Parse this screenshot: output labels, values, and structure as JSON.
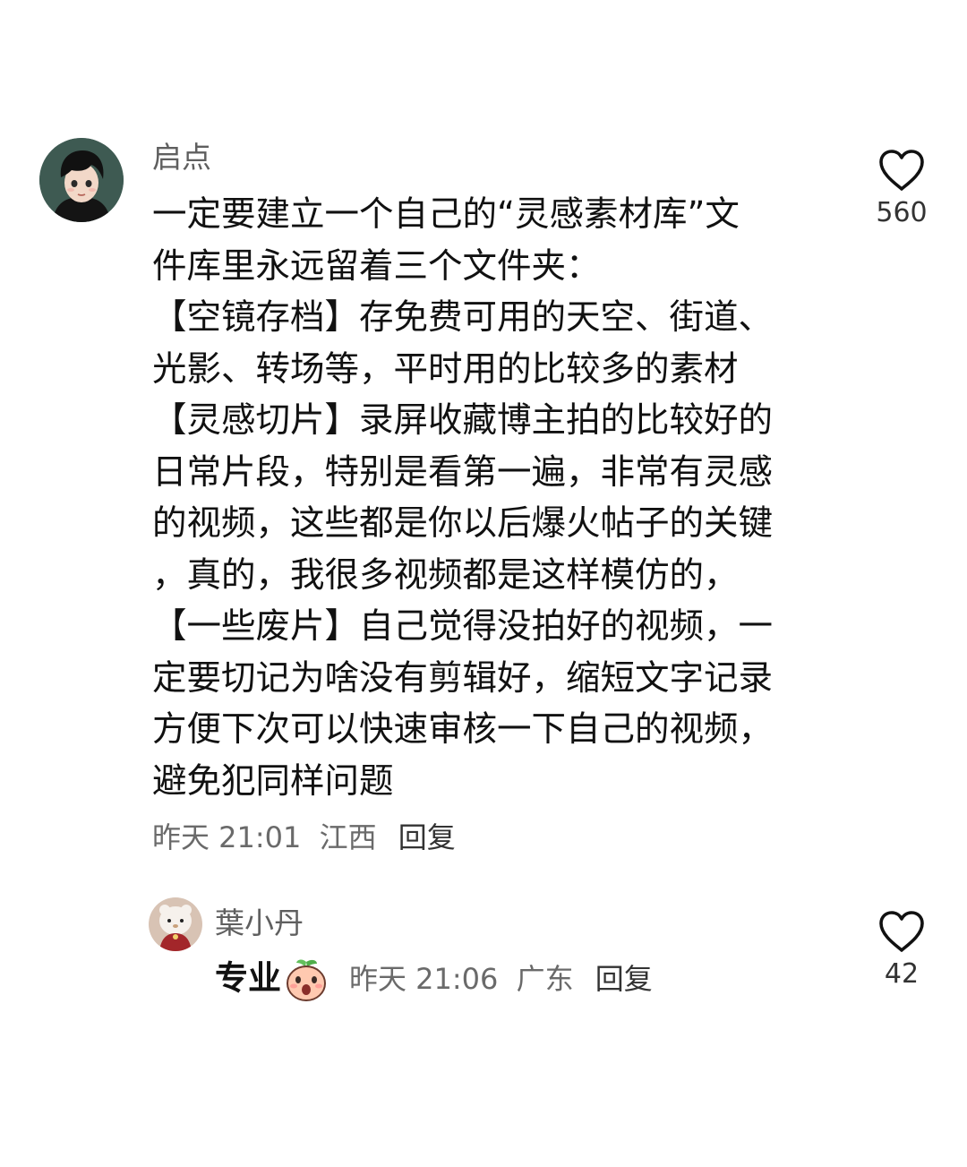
{
  "comments": [
    {
      "username": "启点",
      "lines": [
        "一定要建立一个自己的“灵感素材库”文",
        "件库里永远留着三个文件夹：",
        "【空镜存档】存免费可用的天空、街道、",
        "光影、转场等，平时用的比较多的素材",
        "【灵感切片】录屏收藏博主拍的比较好的",
        "日常片段，特别是看第一遍，非常有灵感",
        "的视频，这些都是你以后爆火帖子的关键",
        "，真的，我很多视频都是这样模仿的，",
        "【一些废片】自己觉得没拍好的视频，一",
        "定要切记为啥没有剪辑好，缩短文字记录",
        "方便下次可以快速审核一下自己的视频，",
        "避免犯同样问题"
      ],
      "time": "昨天 21:01",
      "location": "江西",
      "reply_label": "回复",
      "likes": "560",
      "avatar_icon": "anime-boy-avatar"
    },
    {
      "username": "葉小丹",
      "text": "专业",
      "emoji_icon": "surprised-peach-emoji",
      "time": "昨天 21:06",
      "location": "广东",
      "reply_label": "回复",
      "likes": "42",
      "avatar_icon": "plush-doll-avatar"
    }
  ],
  "colors": {
    "text_primary": "#111111",
    "text_secondary": "#6a6a6a",
    "background": "#ffffff"
  }
}
